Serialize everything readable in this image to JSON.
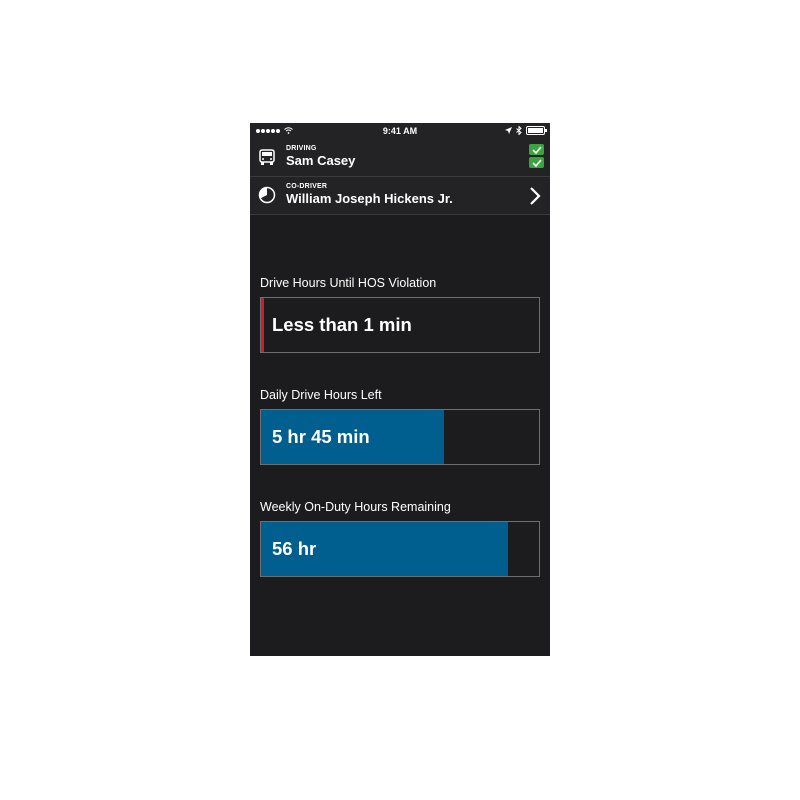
{
  "status_bar": {
    "time": "9:41 AM"
  },
  "driver": {
    "caption": "DRIVING",
    "name": "Sam Casey",
    "icon": "truck-icon",
    "status_checks": [
      "check-icon",
      "check-icon"
    ]
  },
  "codriver": {
    "caption": "CO-DRIVER",
    "name": "William Joseph Hickens Jr.",
    "icon": "clock-pie-icon"
  },
  "metrics": [
    {
      "label": "Drive Hours Until HOS Violation",
      "value": "Less than 1 min",
      "fill_fraction": 0.0,
      "alert": true
    },
    {
      "label": "Daily Drive Hours Left",
      "value": "5 hr 45 min",
      "fill_fraction": 0.66,
      "alert": false
    },
    {
      "label": "Weekly On-Duty Hours Remaining",
      "value": "56 hr",
      "fill_fraction": 0.89,
      "alert": false
    }
  ],
  "colors": {
    "background": "#1c1c1e",
    "header": "#232325",
    "fill": "#005f8e",
    "alert": "#c8202a",
    "check": "#3aa53f"
  }
}
